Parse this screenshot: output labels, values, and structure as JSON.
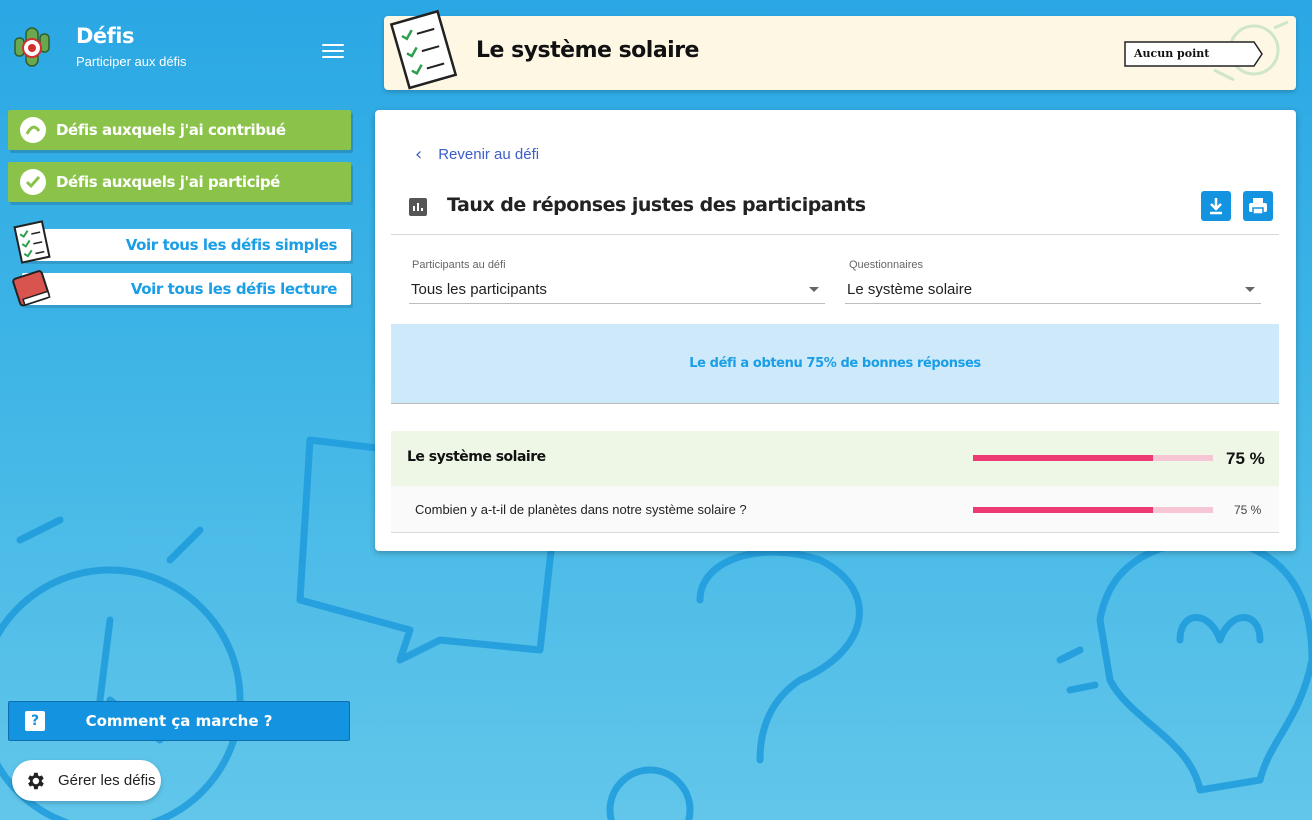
{
  "sidebar": {
    "title": "Défis",
    "subtitle": "Participer aux défis",
    "contributed_label": "Défis auxquels j'ai contribué",
    "participated_label": "Défis auxquels j'ai participé",
    "simple_label": "Voir tous les défis simples",
    "reading_label": "Voir tous les défis lecture",
    "help_label": "Comment ça marche ?",
    "manage_label": "Gérer les défis"
  },
  "header": {
    "title": "Le système solaire",
    "points_label": "Aucun point"
  },
  "main": {
    "back_label": "Revenir au défi",
    "stats_title": "Taux de réponses justes des participants",
    "participants": {
      "label": "Participants au défi",
      "value": "Tous les participants"
    },
    "questionnaires": {
      "label": "Questionnaires",
      "value": "Le système solaire"
    },
    "summary": "Le défi a obtenu 75% de bonnes réponses",
    "quiz_row": {
      "name": "Le système solaire",
      "percent_label": "75 %",
      "percent": 75
    },
    "question_row": {
      "name": "Combien y a-t-il de planètes dans notre système solaire ?",
      "percent_label": "75 %",
      "percent": 75
    }
  },
  "colors": {
    "accent_blue": "#1493e0",
    "green": "#8bc34a",
    "progress": "#ee3a73",
    "progress_track": "#f6c6d4"
  },
  "icons": [
    "cactus-target-icon",
    "menu-icon",
    "contribute-icon",
    "check-icon",
    "checklist-icon",
    "book-icon",
    "question-icon",
    "gear-icon",
    "chevron-left-icon",
    "bar-chart-icon",
    "download-icon",
    "print-icon",
    "dropdown-caret-icon"
  ]
}
